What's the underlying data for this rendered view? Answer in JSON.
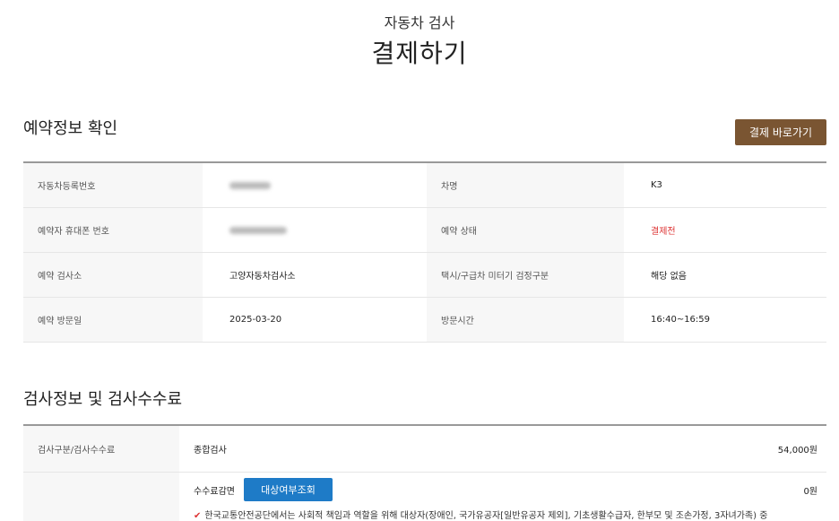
{
  "header": {
    "subtitle": "자동차 검사",
    "title": "결제하기"
  },
  "reservation": {
    "heading": "예약정보 확인",
    "pay_button": "결제 바로가기",
    "rows": [
      {
        "label1": "자동차등록번호",
        "value1": "",
        "label2": "차명",
        "value2": "K3"
      },
      {
        "label1": "예약자 휴대폰 번호",
        "value1": "",
        "label2": "예약 상태",
        "value2": "결제전"
      },
      {
        "label1": "예약 검사소",
        "value1": "고양자동차검사소",
        "label2": "택시/구급차 미터기 검정구분",
        "value2": "해당 없음"
      },
      {
        "label1": "예약 방문일",
        "value1": "2025-03-20",
        "label2": "방문시간",
        "value2": "16:40~16:59"
      }
    ],
    "status_color": "#dd3333"
  },
  "fee": {
    "heading": "검사정보 및 검사수수료",
    "row1_label": "검사구분/검사수수료",
    "inspection_type": "종합검사",
    "inspection_fee": "54,000원",
    "reduction_label": "수수료감면",
    "inquiry_button": "대상여부조회",
    "reduction_amount": "0원",
    "notice": "한국교통안전공단에서는 사회적 책임과 역할을 위해 대상자(장애인, 국가유공자[일반유공자 제외], 기초생활수급자, 한부모 및 조손가정, 3자녀가족) 중",
    "notice_icon": "check-icon"
  },
  "colors": {
    "brand_button": "#7a5532",
    "inquiry_button": "#1e7bc7"
  }
}
